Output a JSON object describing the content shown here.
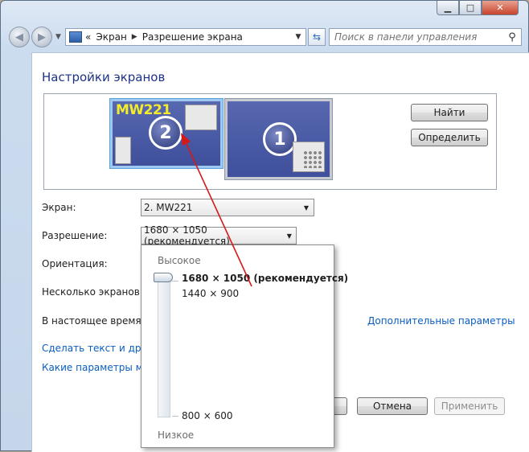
{
  "window": {
    "caption_buttons": {
      "minimize": "▁",
      "maximize": "□",
      "close": "✕"
    }
  },
  "nav": {
    "back_glyph": "◀",
    "forward_glyph": "▶",
    "breadcrumb": [
      "Экран",
      "Разрешение экрана"
    ],
    "crumb_prefix": "«",
    "search_placeholder": "Поиск в панели управления"
  },
  "page": {
    "title": "Настройки экранов"
  },
  "monitors": [
    {
      "number": "2",
      "name": "MW221",
      "selected": true
    },
    {
      "number": "1",
      "selected": false
    }
  ],
  "buttons": {
    "find": "Найти",
    "identify": "Определить",
    "cancel": "Отмена",
    "apply": "Применить"
  },
  "form": {
    "display_label": "Экран:",
    "display_value": "2. MW221",
    "resolution_label": "Разрешение:",
    "resolution_value": "1680 × 1050 (рекомендуется)",
    "orientation_label": "Ориентация:",
    "multiple_label": "Несколько экранов:",
    "current_label": "В настоящее время эт",
    "advanced_link": "Дополнительные параметры",
    "text_link": "Сделать текст и другие",
    "which_link": "Какие параметры мон"
  },
  "resolution_popup": {
    "high_label": "Высокое",
    "low_label": "Низкое",
    "options": [
      {
        "label": "1680 × 1050 (рекомендуется)",
        "selected": true
      },
      {
        "label": "1440 × 900",
        "selected": false
      },
      {
        "label": "800 × 600",
        "selected": false
      }
    ]
  },
  "colors": {
    "title_blue": "#1e3287",
    "link_blue": "#0a5ec1",
    "monitor_fill": "#4656a3",
    "monitor_label_yellow": "#f4ec2a",
    "annotation_red": "#d81818"
  }
}
